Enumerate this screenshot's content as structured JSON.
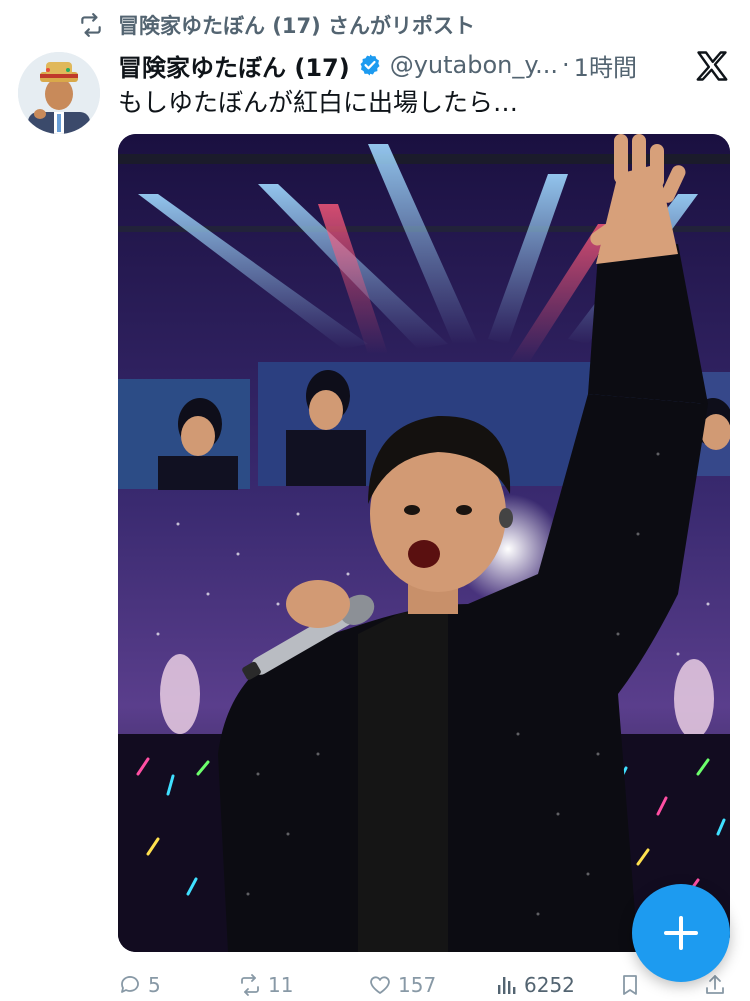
{
  "repost": {
    "text": "冒険家ゆたぼん (17) さんがリポスト",
    "icon": "repost-icon"
  },
  "tweet": {
    "display_name": "冒険家ゆたぼん (17)",
    "handle": "@yutabon_y...",
    "separator": "·",
    "time": "1時間",
    "text": "もしゆたぼんが紅白に出場したら…",
    "verified_color": "#1d9bf0"
  },
  "actions": {
    "replies": "5",
    "reposts": "11",
    "likes": "157",
    "views": "6252"
  },
  "fab": {
    "icon": "plus-icon",
    "color": "#1d9bf0"
  },
  "brand": {
    "logo": "x-logo-icon"
  }
}
